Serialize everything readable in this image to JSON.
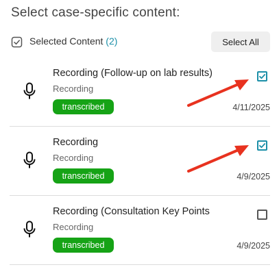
{
  "header": {
    "title": "Select case-specific content:"
  },
  "selection": {
    "label": "Selected Content",
    "count": "(2)",
    "select_all_label": "Select All"
  },
  "items": [
    {
      "title": "Recording (Follow-up on lab results)",
      "type": "Recording",
      "status": "transcribed",
      "date": "4/11/2025",
      "checked": true
    },
    {
      "title": "Recording",
      "type": "Recording",
      "status": "transcribed",
      "date": "4/9/2025",
      "checked": true
    },
    {
      "title": "Recording (Consultation Key Points",
      "type": "Recording",
      "status": "transcribed",
      "date": "4/9/2025",
      "checked": false
    }
  ],
  "colors": {
    "accent": "#1b8fa8",
    "badge": "#16a316",
    "arrow": "#e8321f"
  },
  "icons": {
    "item": "microphone-icon",
    "selected": "checkbox-selected-icon",
    "annotation": "red-arrow-icon"
  }
}
